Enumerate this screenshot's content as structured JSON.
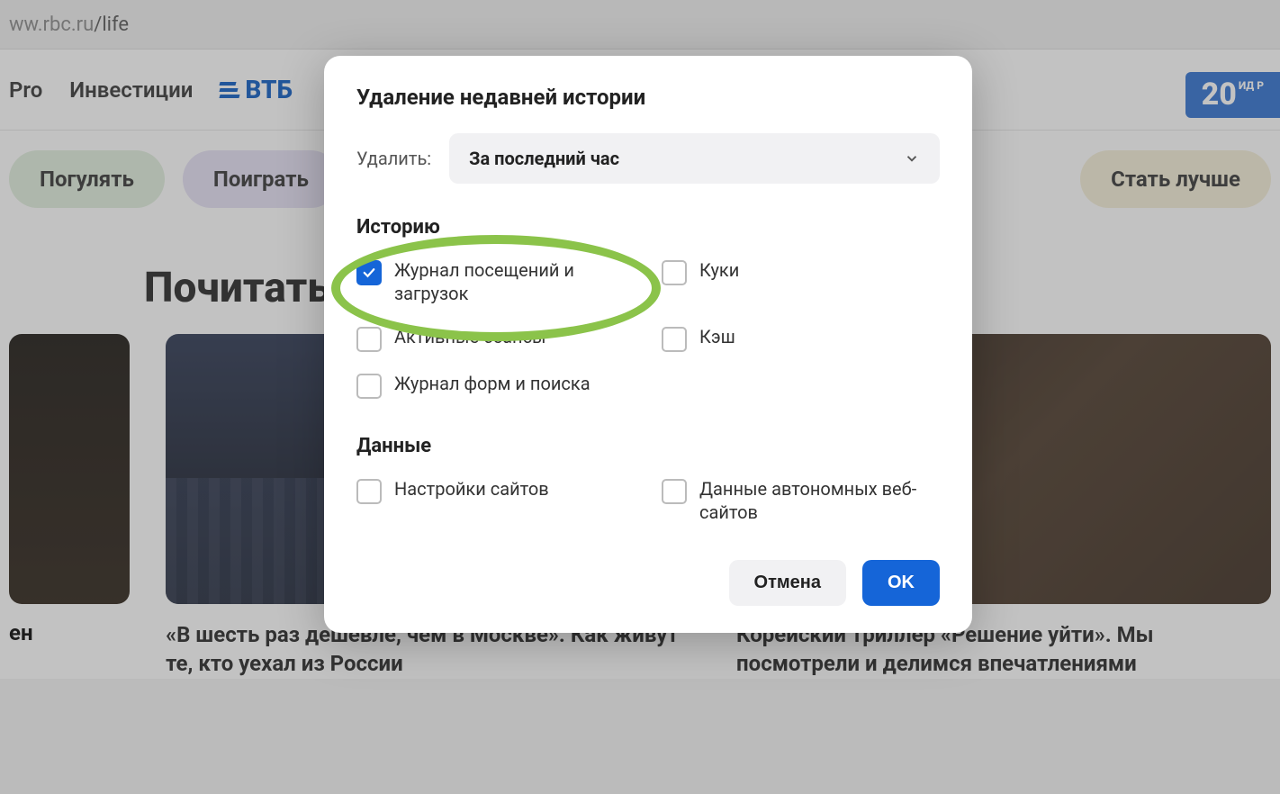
{
  "url": {
    "host": "ww.rbc.ru",
    "path": "/life"
  },
  "nav": {
    "pro": "Pro",
    "invest": "Инвестиции",
    "vtb": "ВТБ"
  },
  "badge": {
    "num": "20",
    "sub": "ИД\nР"
  },
  "pills": {
    "walk": "Погулять",
    "play": "Поиграть",
    "better": "Стать лучше"
  },
  "section": {
    "title": "Почитать"
  },
  "cards": {
    "left_frag": "ен",
    "card1": "«В шесть раз дешевле, чем в Москве». Как живут те, кто уехал из России",
    "card2": "Корейский триллер «Решение уйти». Мы посмотрели и делимся впечатлениями"
  },
  "modal": {
    "title": "Удаление недавней истории",
    "delete_label": "Удалить:",
    "dropdown_value": "За последний час",
    "section_history": "Историю",
    "section_data": "Данные",
    "checks": {
      "history_downloads": "Журнал посещений и загрузок",
      "cookies": "Куки",
      "cache": "Кэш",
      "active_sessions": "Активные сеансы",
      "forms_search": "Журнал форм и поиска",
      "site_settings": "Настройки сайтов",
      "offline_data": "Данные автономных веб-сайтов"
    },
    "cancel": "Отмена",
    "ok": "OK"
  }
}
